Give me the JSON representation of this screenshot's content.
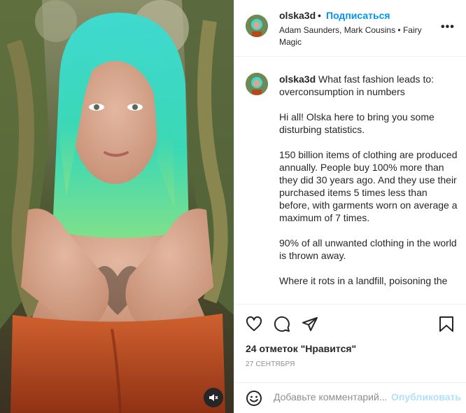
{
  "header": {
    "username": "olska3d",
    "separator": "•",
    "follow_label": "Подписаться",
    "subtitle": "Adam Saunders, Mark Cousins • Fairy Magic",
    "more_label": "•••"
  },
  "caption": {
    "username": "olska3d",
    "title": "What fast fashion leads to: overconsumption in numbers",
    "paragraphs": [
      "Hi all! Olska here to bring you some disturbing statistics.",
      "150 billion items of clothing are produced annually. People buy 100% more than they did 30 years ago. And they use their purchased items 5 times less than before, with garments worn on average a maximum of 7 times.",
      "90% of all unwanted clothing in the world is thrown away.",
      "Where it rots in a landfill, poisoning the"
    ]
  },
  "post": {
    "likes": "24 отметок \"Нравится\"",
    "date": "27 СЕНТЯБРЯ"
  },
  "comment": {
    "placeholder": "Добавьте комментарий...",
    "publish_label": "Опубликовать"
  },
  "icons": {
    "like": "heart-icon",
    "comment": "comment-icon",
    "share": "send-icon",
    "save": "bookmark-icon",
    "emoji": "emoji-icon",
    "mute": "speaker-muted-icon"
  },
  "colors": {
    "link_blue": "#0095f6",
    "publish_disabled": "#b2dffc",
    "hair": "#3ed8c3",
    "top": "#b8471e"
  }
}
